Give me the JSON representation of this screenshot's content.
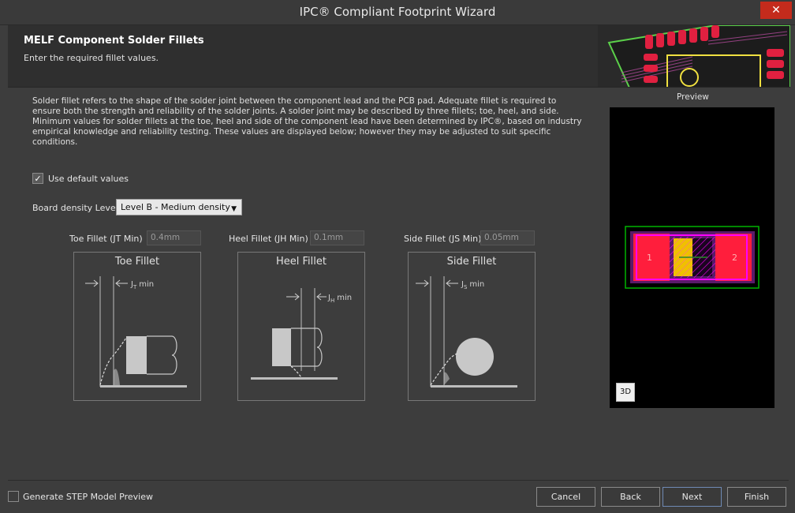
{
  "window": {
    "title": "IPC® Compliant Footprint Wizard",
    "close_glyph": "✕"
  },
  "header": {
    "title": "MELF Component Solder Fillets",
    "subtitle": "Enter the required fillet values."
  },
  "description": "Solder fillet refers to the shape of the solder joint between the component lead and the PCB pad. Adequate fillet is required to ensure both the strength and reliability of the solder joints. A solder joint may be described by three fillets; toe, heel, and side. Minimum values for solder fillets at the toe, heel and side of the component lead have been determined by IPC®, based on industry empirical knowledge and reliability testing. These values are displayed below; however they may be adjusted to suit specific conditions.",
  "use_default": {
    "label": "Use default values",
    "checked": true,
    "check_glyph": "✓"
  },
  "density": {
    "label": "Board density Level",
    "value": "Level B - Medium density",
    "arrow_glyph": "▼"
  },
  "fillets": {
    "toe": {
      "label": "Toe Fillet (JT Min)",
      "value": "0.4mm",
      "diagram_title": "Toe Fillet",
      "dim_j": "J",
      "dim_sub": "T",
      "dim_min": "min"
    },
    "heel": {
      "label": "Heel Fillet (JH Min)",
      "value": "0.1mm",
      "diagram_title": "Heel Fillet",
      "dim_j": "J",
      "dim_sub": "H",
      "dim_min": "min"
    },
    "side": {
      "label": "Side Fillet (JS Min)",
      "value": "0.05mm",
      "diagram_title": "Side Fillet",
      "dim_j": "J",
      "dim_sub": "S",
      "dim_min": "min"
    }
  },
  "preview": {
    "label": "Preview",
    "pad1": "1",
    "pad2": "2",
    "btn_3d": "3D"
  },
  "footer": {
    "step_label": "Generate STEP Model Preview",
    "step_checked": false,
    "cancel": "Cancel",
    "back": "Back",
    "next": "Next",
    "finish": "Finish"
  },
  "colors": {
    "pad_red": "#ff1e3c",
    "pad_magenta": "#ff00ff",
    "outline_green": "#00b400",
    "body_yellow": "#ffc800",
    "accent_blue": "#6f8ab4"
  }
}
